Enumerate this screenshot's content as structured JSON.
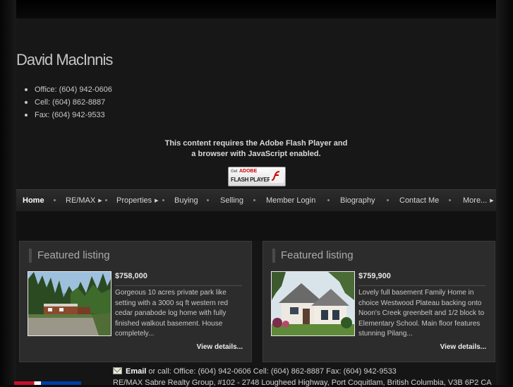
{
  "site": {
    "title": "David MacInnis",
    "contacts": [
      "Office: (604) 942-0606",
      "Cell: (604) 862-8887",
      "Fax: (604) 942-9533"
    ]
  },
  "flash": {
    "message_line1": "This content requires the Adobe Flash Player and",
    "message_line2": "a browser with JavaScript enabled.",
    "badge_get": "Get",
    "badge_adobe": "ADOBE",
    "badge_player": "FLASH PLAYER"
  },
  "nav": {
    "items": [
      {
        "label": "Home",
        "active": true,
        "submenu": false
      },
      {
        "label": "RE/MAX",
        "active": false,
        "submenu": true
      },
      {
        "label": "Properties",
        "active": false,
        "submenu": true
      },
      {
        "label": "Buying",
        "active": false,
        "submenu": false
      },
      {
        "label": "Selling",
        "active": false,
        "submenu": false
      },
      {
        "label": "Member Login",
        "active": false,
        "submenu": false
      },
      {
        "label": "Biography",
        "active": false,
        "submenu": false
      },
      {
        "label": "Contact Me",
        "active": false,
        "submenu": false
      },
      {
        "label": "More...",
        "active": false,
        "submenu": true
      }
    ]
  },
  "listings": [
    {
      "heading": "Featured listing",
      "price": "$758,000",
      "description": "Gorgeous 10 acres private park like setting with a 3000 sq ft  western red cedar panabode log home with fully finished walkout basement. House completely...",
      "link": "View details..."
    },
    {
      "heading": "Featured listing",
      "price": "$759,900",
      "description": "Lovely full basement Family Home in choice Westwood Plateau backing onto Noon's Creek greenbelt and 1/2 block to Elementary School. Main floor features stunning Pilang...",
      "link": "View details..."
    }
  ],
  "footer": {
    "email_label": "Email",
    "contact_line": " or call:  Office: (604) 942-0606  Cell: (604) 862-8887  Fax: (604) 942-9533",
    "address": "RE/MAX Sabre Realty Group, #102 - 2748 Lougheed Highway, Port Coquitlam, British Columbia, V3B 6P2 CA"
  },
  "colors": {
    "background": "#0b0b0b",
    "panel": "#151515",
    "card": "#2c2c2c",
    "nav": "#262626"
  }
}
